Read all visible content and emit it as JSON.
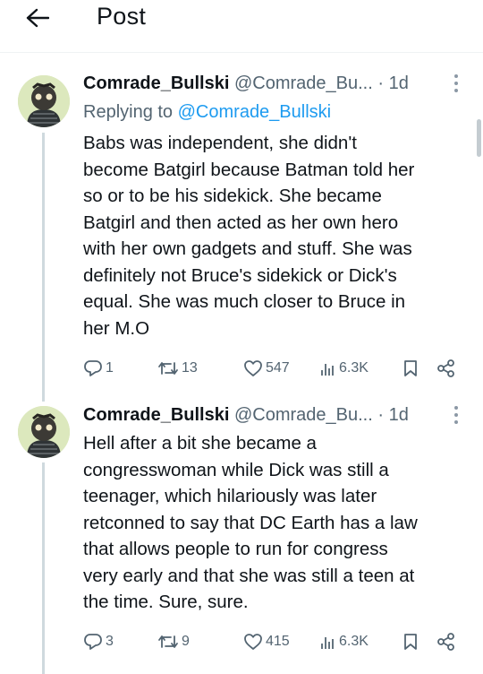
{
  "header": {
    "back_icon": "arrow-left-icon",
    "title": "Post"
  },
  "tweets": [
    {
      "author_name": "Comrade_Bullski",
      "handle": "@Comrade_Bu...",
      "separator": "·",
      "time": "1d",
      "reply_prefix": "Replying to",
      "reply_mention": "@Comrade_Bullski",
      "lines": [
        "Babs was independent, she didn't",
        "become Batgirl because Batman told her",
        "so or to be his sidekick. She became",
        "Batgirl and then acted as her own hero",
        "with her own gadgets and stuff. She was",
        "definitely not Bruce's sidekick or Dick's",
        "equal. She was much closer to Bruce in",
        "her M.O"
      ],
      "replies": "1",
      "reposts": "13",
      "likes": "547",
      "views": "6.3K"
    },
    {
      "author_name": "Comrade_Bullski",
      "handle": "@Comrade_Bu...",
      "separator": "·",
      "time": "1d",
      "lines": [
        "Hell after a bit she became a",
        "congresswoman while Dick was still a",
        "teenager, which hilariously was later",
        "retconned to say that DC Earth has a law",
        "that allows people to run for congress",
        "very early and that she was still a teen at",
        "the time. Sure, sure."
      ],
      "replies": "3",
      "reposts": "9",
      "likes": "415",
      "views": "6.3K"
    }
  ],
  "colors": {
    "text": "#0f1419",
    "secondary": "#536471",
    "link": "#1d9bf0",
    "thread_line": "#cfd9de"
  }
}
